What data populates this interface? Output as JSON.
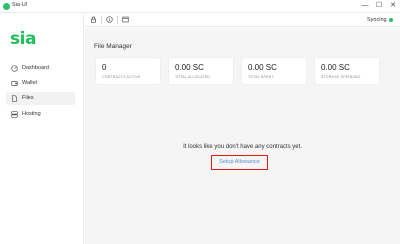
{
  "window": {
    "title": "Sia-UI",
    "controls": {
      "minimize": "—",
      "maximize": "☐",
      "close": "✕"
    }
  },
  "sidebar": {
    "logo": "sia",
    "items": [
      {
        "label": "Dashboard",
        "icon": "dashboard-icon",
        "active": false
      },
      {
        "label": "Wallet",
        "icon": "wallet-icon",
        "active": false
      },
      {
        "label": "Files",
        "icon": "files-icon",
        "active": true
      },
      {
        "label": "Hosting",
        "icon": "hosting-icon",
        "active": false
      }
    ]
  },
  "topbar": {
    "icons": [
      "lock-icon",
      "info-icon",
      "terminal-icon"
    ],
    "sync_status": "Syncing"
  },
  "main": {
    "title": "File Manager",
    "cards": [
      {
        "value": "0",
        "label": "CONTRACTS ACTIVE"
      },
      {
        "value": "0.00 SC",
        "label": "TOTAL ALLOCATED"
      },
      {
        "value": "0.00 SC",
        "label": "TOTAL SPENT"
      },
      {
        "value": "0.00 SC",
        "label": "STORAGE SPENDING"
      }
    ],
    "empty_message": "It looks like you don't have any contracts yet.",
    "setup_button": "Setup Allowance"
  },
  "colors": {
    "brand_green": "#20c05c",
    "highlight_red": "#e0191b",
    "link_blue": "#5d8fd0",
    "main_bg": "#f5f5f5"
  }
}
